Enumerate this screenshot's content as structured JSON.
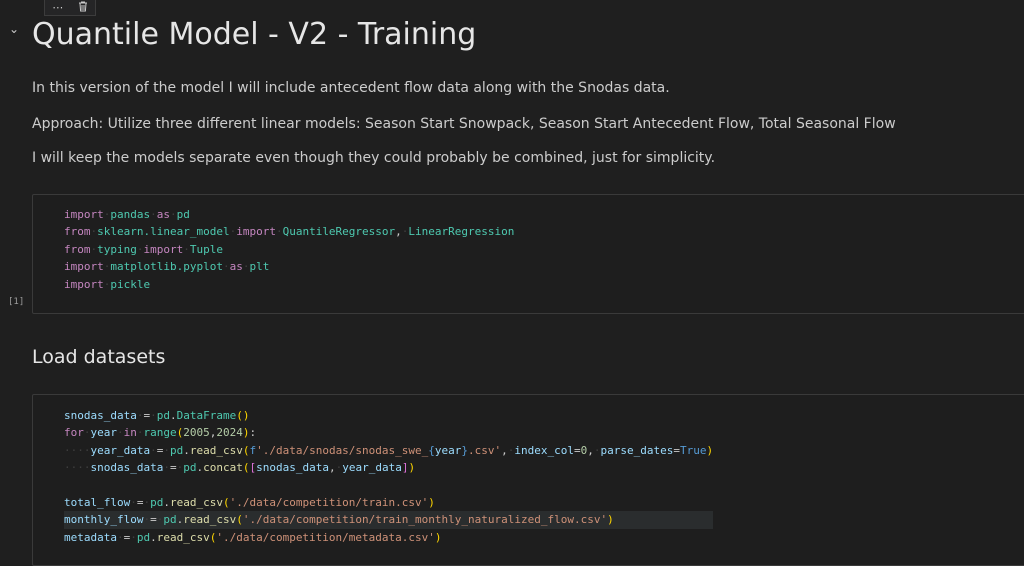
{
  "toolbar": {
    "more_icon": "more-icon",
    "delete_icon": "trash-icon"
  },
  "markdown1": {
    "title": "Quantile Model - V2 - Training",
    "paragraphs": [
      "In this version of the model I will include antecedent flow data along with the Snodas data.",
      "Approach: Utilize three different linear models: Season Start Snowpack, Season Start Antecedent Flow, Total Seasonal Flow",
      "I will keep the models separate even though they could probably be combined, just for simplicity."
    ]
  },
  "cell1": {
    "execution_count": "[1]"
  },
  "markdown2": {
    "title": "Load datasets"
  },
  "colors": {
    "background": "#1f1f1f",
    "keyword": "#c586c0",
    "module": "#4ec9b0",
    "string": "#ce9178",
    "function": "#dcdcaa",
    "variable": "#9cdcfe"
  }
}
